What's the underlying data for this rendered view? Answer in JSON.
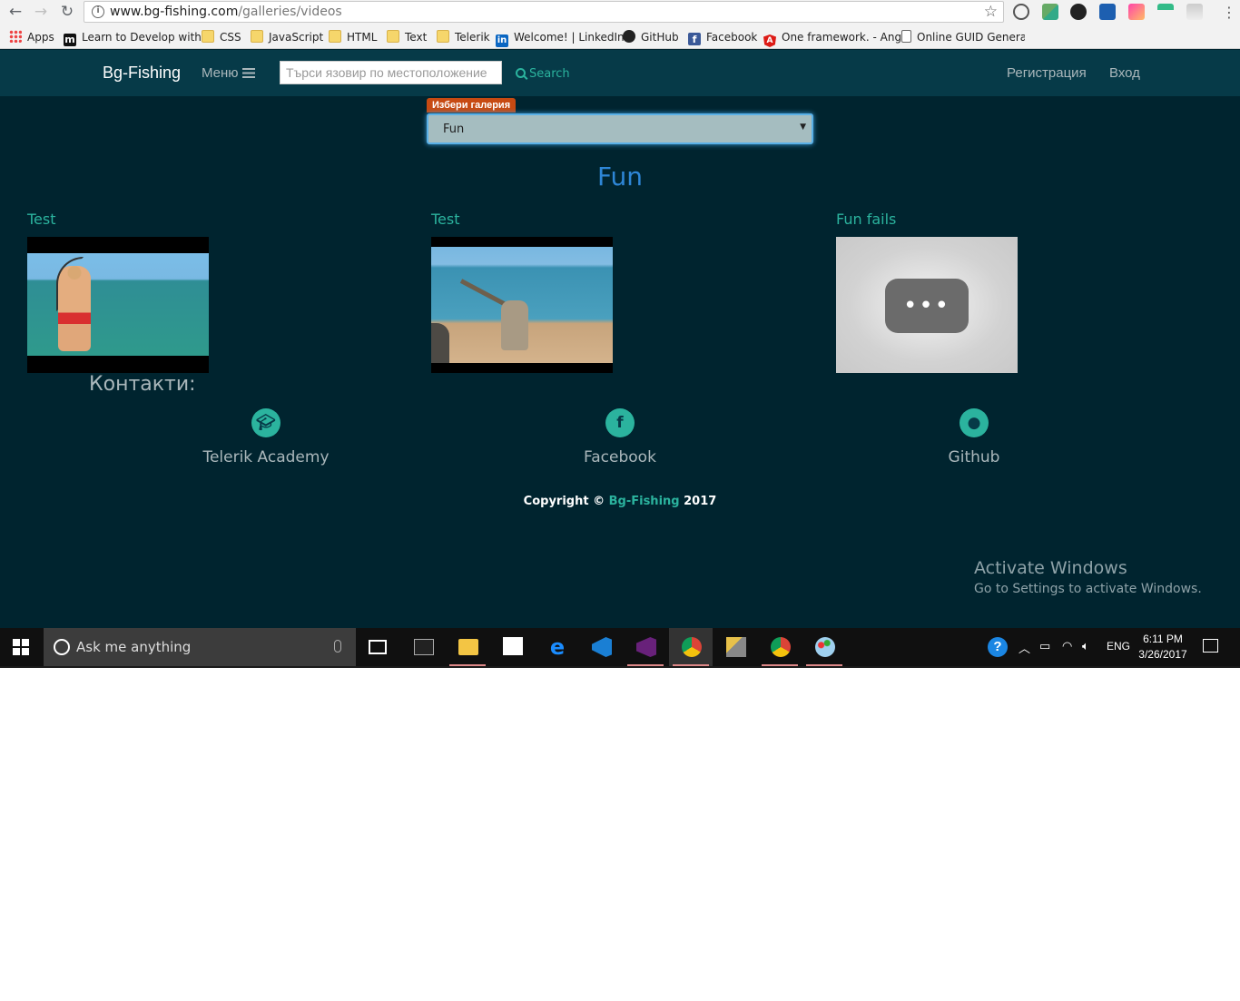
{
  "browser": {
    "url_host": "www.bg-fishing.com",
    "url_path": "/galleries/videos",
    "bookmarks": [
      "Apps",
      "Learn to Develop with",
      "CSS",
      "JavaScript",
      "HTML",
      "Text",
      "Telerik",
      "Welcome! | LinkedIn",
      "GitHub",
      "Facebook",
      "One framework. - Ang",
      "Online GUID Generato"
    ]
  },
  "site_nav": {
    "brand": "Bg-Fishing",
    "menu_label": "Меню",
    "search_placeholder": "Търси язовир по местоположение",
    "search_button": "Search",
    "register": "Регистрация",
    "login": "Вход"
  },
  "gallery": {
    "select_label": "Избери галерия",
    "selected": "Fun",
    "title": "Fun",
    "videos": [
      {
        "title": "Test",
        "thumbnail": "woman-fishing-in-sea"
      },
      {
        "title": "Test",
        "thumbnail": "man-with-log-on-beach"
      },
      {
        "title": "Fun fails",
        "thumbnail": "loading-placeholder"
      }
    ]
  },
  "footer": {
    "contacts_title": "Контакти:",
    "contacts": [
      {
        "label": "Telerik Academy",
        "icon": "graduation-cap-icon"
      },
      {
        "label": "Facebook",
        "icon": "facebook-icon"
      },
      {
        "label": "Github",
        "icon": "github-icon"
      }
    ],
    "copyright_prefix": "Copyright ©",
    "copyright_brand": "Bg-Fishing",
    "copyright_year": "2017"
  },
  "watermark": {
    "line1": "Activate Windows",
    "line2": "Go to Settings to activate Windows."
  },
  "taskbar": {
    "search_text": "Ask me anything",
    "language": "ENG",
    "time": "6:11 PM",
    "date": "3/26/2017"
  },
  "colors": {
    "page_bg": "#00242f",
    "navbar_bg": "#063a48",
    "accent_teal": "#2bb39e",
    "title_blue": "#2e86d6",
    "tag_orange": "#c74a12"
  }
}
